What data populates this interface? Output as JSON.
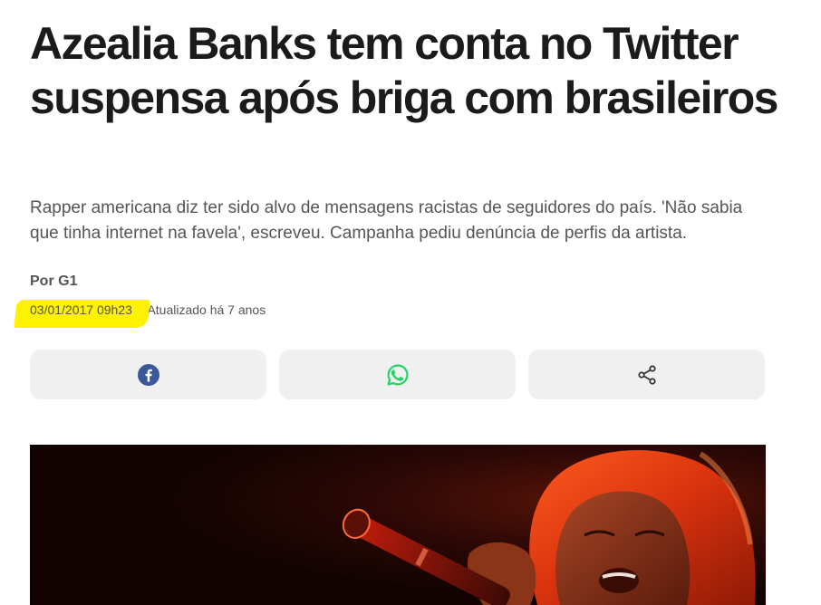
{
  "article": {
    "headline": "Azealia Banks tem conta no Twitter suspensa após briga com brasileiros",
    "subtitle": "Rapper americana diz ter sido alvo de mensagens racistas de seguidores do país. 'Não sabia que tinha internet na favela', escreveu. Campanha pediu denúncia de perfis da artista.",
    "byline": "Por G1",
    "published": "03/01/2017 09h23",
    "separator": "·",
    "updated": "Atualizado há 7 anos"
  },
  "share": {
    "buttons": [
      {
        "icon": "facebook-icon",
        "color": "#3b5998"
      },
      {
        "icon": "whatsapp-icon",
        "color": "#25d366"
      },
      {
        "icon": "share-icon",
        "color": "#333333"
      }
    ]
  },
  "colors": {
    "highlight": "#fff200",
    "button_bg": "#f0f0f0",
    "headline": "#1b1b1b",
    "body_text": "#555555"
  }
}
